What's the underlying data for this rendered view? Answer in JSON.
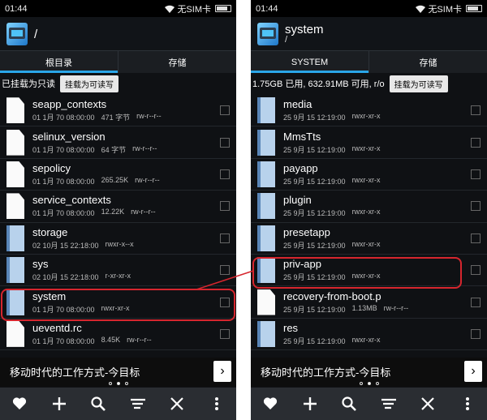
{
  "left": {
    "status": {
      "time": "01:44",
      "carrier": "无SIM卡"
    },
    "title": "/",
    "subtitle": "",
    "tabs": [
      {
        "label": "根目录",
        "active": true
      },
      {
        "label": "存储",
        "active": false
      }
    ],
    "info": "已挂载为只读",
    "mount_button": "挂载为可读写",
    "items": [
      {
        "icon": "file",
        "name": "seapp_contexts",
        "date": "01 1月 70 08:00:00",
        "size": "471 字节",
        "perm": "rw-r--r--"
      },
      {
        "icon": "file",
        "name": "selinux_version",
        "date": "01 1月 70 08:00:00",
        "size": "64 字节",
        "perm": "rw-r--r--"
      },
      {
        "icon": "file",
        "name": "sepolicy",
        "date": "01 1月 70 08:00:00",
        "size": "265.25K",
        "perm": "rw-r--r--"
      },
      {
        "icon": "file",
        "name": "service_contexts",
        "date": "01 1月 70 08:00:00",
        "size": "12.22K",
        "perm": "rw-r--r--"
      },
      {
        "icon": "folder",
        "name": "storage",
        "date": "02 10月 15 22:18:00",
        "size": "",
        "perm": "rwxr-x--x"
      },
      {
        "icon": "folder",
        "name": "sys",
        "date": "02 10月 15 22:18:00",
        "size": "",
        "perm": "r-xr-xr-x"
      },
      {
        "icon": "folder",
        "name": "system",
        "date": "01 1月 70 08:00:00",
        "size": "",
        "perm": "rwxr-xr-x"
      },
      {
        "icon": "file",
        "name": "ueventd.rc",
        "date": "01 1月 70 08:00:00",
        "size": "8.45K",
        "perm": "rw-r--r--"
      }
    ],
    "ad_text": "移动时代的工作方式-今目标",
    "ad_arrow": "›"
  },
  "right": {
    "status": {
      "time": "01:44",
      "carrier": "无SIM卡"
    },
    "title": "system",
    "subtitle": "/",
    "tabs": [
      {
        "label": "SYSTEM",
        "active": true
      },
      {
        "label": "存储",
        "active": false
      }
    ],
    "info": "1.75GB 已用, 632.91MB 可用, r/o",
    "mount_button": "挂载为可读写",
    "items": [
      {
        "icon": "folder",
        "name": "media",
        "date": "25 9月 15 12:19:00",
        "size": "",
        "perm": "rwxr-xr-x"
      },
      {
        "icon": "folder",
        "name": "MmsTts",
        "date": "25 9月 15 12:19:00",
        "size": "",
        "perm": "rwxr-xr-x"
      },
      {
        "icon": "folder",
        "name": "payapp",
        "date": "25 9月 15 12:19:00",
        "size": "",
        "perm": "rwxr-xr-x"
      },
      {
        "icon": "folder",
        "name": "plugin",
        "date": "25 9月 15 12:19:00",
        "size": "",
        "perm": "rwxr-xr-x"
      },
      {
        "icon": "folder",
        "name": "presetapp",
        "date": "25 9月 15 12:19:00",
        "size": "",
        "perm": "rwxr-xr-x"
      },
      {
        "icon": "folder",
        "name": "priv-app",
        "date": "25 9月 15 12:19:00",
        "size": "",
        "perm": "rwxr-xr-x"
      },
      {
        "icon": "file",
        "name": "recovery-from-boot.p",
        "date": "25 9月 15 12:19:00",
        "size": "1.13MB",
        "perm": "rw-r--r--"
      },
      {
        "icon": "folder",
        "name": "res",
        "date": "25 9月 15 12:19:00",
        "size": "",
        "perm": "rwxr-xr-x"
      }
    ],
    "ad_text": "移动时代的工作方式-今目标",
    "ad_arrow": "›"
  },
  "toolbar_icons": [
    "heart-icon",
    "plus-icon",
    "search-icon",
    "sort-icon",
    "close-icon",
    "more-icon"
  ]
}
